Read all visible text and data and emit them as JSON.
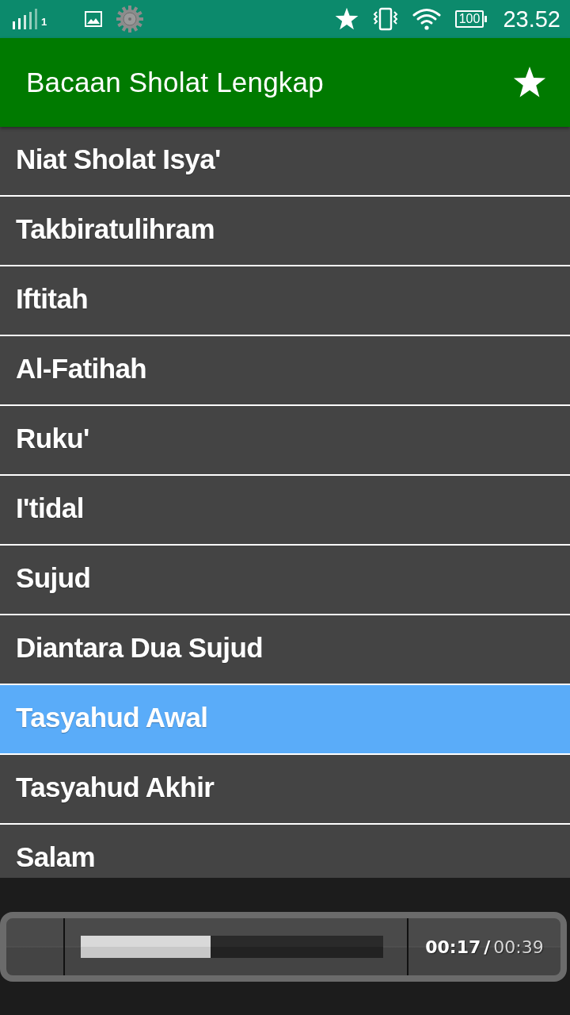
{
  "status_bar": {
    "sim_slot": "1",
    "battery": "100",
    "time": "23.52"
  },
  "toolbar": {
    "title": "Bacaan Sholat Lengkap"
  },
  "list": {
    "items": [
      {
        "label": "Niat Sholat Isya'",
        "selected": false
      },
      {
        "label": "Takbiratulihram",
        "selected": false
      },
      {
        "label": "Iftitah",
        "selected": false
      },
      {
        "label": "Al-Fatihah",
        "selected": false
      },
      {
        "label": "Ruku'",
        "selected": false
      },
      {
        "label": "I'tidal",
        "selected": false
      },
      {
        "label": "Sujud",
        "selected": false
      },
      {
        "label": "Diantara Dua Sujud",
        "selected": false
      },
      {
        "label": "Tasyahud Awal",
        "selected": true
      },
      {
        "label": "Tasyahud Akhir",
        "selected": false
      },
      {
        "label": "Salam",
        "selected": false
      }
    ]
  },
  "player": {
    "level": 0.43,
    "elapsed": "00:17",
    "separator": "/",
    "total": "00:39"
  }
}
